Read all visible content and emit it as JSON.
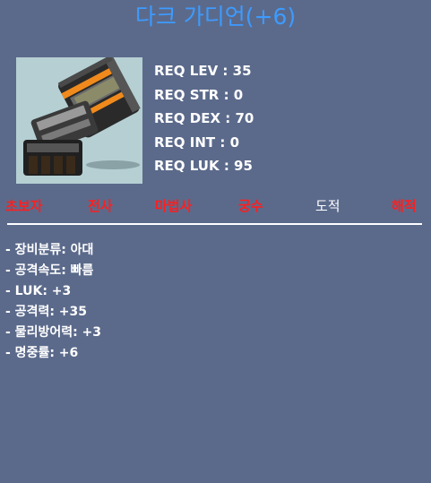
{
  "item": {
    "name": "다크 가디언(+6)",
    "icon": "dark-guardian-glove-icon"
  },
  "requirements": [
    "REQ LEV : 35",
    "REQ STR : 0",
    "REQ DEX : 70",
    "REQ INT : 0",
    "REQ LUK : 95"
  ],
  "job_classes": [
    {
      "label": "초보자",
      "allowed": false
    },
    {
      "label": "전사",
      "allowed": false
    },
    {
      "label": "마법사",
      "allowed": false
    },
    {
      "label": "궁수",
      "allowed": false
    },
    {
      "label": "도적",
      "allowed": true
    },
    {
      "label": "해적",
      "allowed": false
    }
  ],
  "stats": [
    "- 장비분류: 아대",
    "- 공격속도: 빠름",
    "- LUK: +3",
    "- 공격력: +35",
    "- 물리방어력: +3",
    "- 명중률: +6"
  ],
  "colors": {
    "background": "#5b6a8b",
    "title": "#3d9bff",
    "disallowed_class": "#ff1e1e",
    "allowed_class": "#ffffff"
  }
}
